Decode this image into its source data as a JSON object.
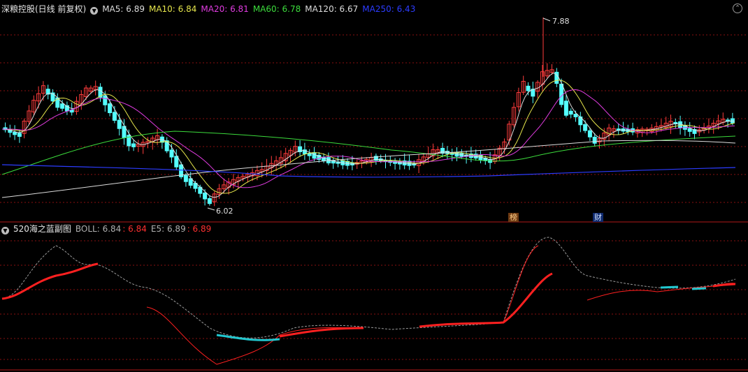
{
  "header": {
    "stock_title": "深粮控股(日线 前复权)",
    "ma_items": [
      {
        "label": "MA5: 6.89",
        "color": "#dcdcdc"
      },
      {
        "label": "MA10: 6.84",
        "color": "#e6e64c"
      },
      {
        "label": "MA20: 6.81",
        "color": "#e03ce0"
      },
      {
        "label": "MA60: 6.78",
        "color": "#3cdc3c"
      },
      {
        "label": "MA120: 6.67",
        "color": "#dcdcdc"
      },
      {
        "label": "MA250: 6.43",
        "color": "#2c3cff"
      }
    ]
  },
  "sub_header": {
    "indicator_title": "520海之蓝副图",
    "items": [
      {
        "label": "BOLL: 6.84",
        "color": "#b0b0b0"
      },
      {
        "label": ": 6.84",
        "color": "#ff3030"
      },
      {
        "label": "E5: 6.89",
        "color": "#b0b0b0"
      },
      {
        "label": ": 6.89",
        "color": "#ff3030"
      }
    ]
  },
  "badges": {
    "bang": "榜",
    "cai": "财"
  },
  "annotations": {
    "high_label": "7.88",
    "low_label": "6.02"
  },
  "colors": {
    "up": "#ff3c3c",
    "down": "#54ffff",
    "grid": "#8a1010"
  },
  "chart_data": {
    "type": "candlestick",
    "high": 7.88,
    "low": 6.02,
    "ma_last": {
      "MA5": 6.89,
      "MA10": 6.84,
      "MA20": 6.81,
      "MA60": 6.78,
      "MA120": 6.67,
      "MA250": 6.43
    },
    "boll_last": 6.84,
    "e5_last": 6.89
  }
}
